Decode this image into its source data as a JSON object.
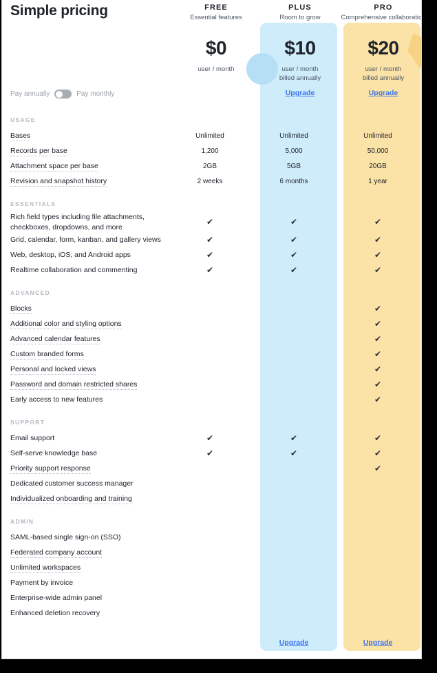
{
  "title": "Simple pricing",
  "billing": {
    "annual_label": "Pay annually",
    "monthly_label": "Pay monthly",
    "selected": "annually"
  },
  "plans": [
    {
      "name": "FREE",
      "tagline": "Essential features",
      "price": "$0",
      "unit": "user / month",
      "billed": "",
      "upgrade_label": "",
      "accent": "#ffffff"
    },
    {
      "name": "PLUS",
      "tagline": "Room to grow",
      "price": "$10",
      "unit": "user / month",
      "billed": "billed annually",
      "upgrade_label": "Upgrade",
      "accent": "#cfecfb"
    },
    {
      "name": "PRO",
      "tagline": "Comprehensive collaboration",
      "price": "$20",
      "unit": "user / month",
      "billed": "billed annually",
      "upgrade_label": "Upgrade",
      "accent": "#fbe3a7"
    }
  ],
  "link_color": "#3b74f2",
  "sections": [
    {
      "heading": "USAGE",
      "rows": [
        {
          "label": "Bases",
          "dotted": true,
          "free": "Unlimited",
          "plus": "Unlimited",
          "pro": "Unlimited"
        },
        {
          "label": "Records per base",
          "dotted": true,
          "free": "1,200",
          "plus": "5,000",
          "pro": "50,000"
        },
        {
          "label": "Attachment space per base",
          "dotted": true,
          "free": "2GB",
          "plus": "5GB",
          "pro": "20GB"
        },
        {
          "label": "Revision and snapshot history",
          "dotted": true,
          "free": "2 weeks",
          "plus": "6 months",
          "pro": "1 year"
        }
      ]
    },
    {
      "heading": "ESSENTIALS",
      "rows": [
        {
          "label": "Rich field types including file attachments, checkboxes, dropdowns, and more",
          "dotted": false,
          "free": "check",
          "plus": "check",
          "pro": "check"
        },
        {
          "label": "Grid, calendar, form, kanban, and gallery views",
          "dotted": false,
          "free": "check",
          "plus": "check",
          "pro": "check"
        },
        {
          "label": "Web, desktop, iOS, and Android apps",
          "dotted": false,
          "free": "check",
          "plus": "check",
          "pro": "check"
        },
        {
          "label": "Realtime collaboration and commenting",
          "dotted": false,
          "free": "check",
          "plus": "check",
          "pro": "check"
        }
      ]
    },
    {
      "heading": "ADVANCED",
      "rows": [
        {
          "label": "Blocks",
          "dotted": true,
          "free": "",
          "plus": "",
          "pro": "check"
        },
        {
          "label": "Additional color and styling options",
          "dotted": true,
          "free": "",
          "plus": "",
          "pro": "check"
        },
        {
          "label": "Advanced calendar features",
          "dotted": true,
          "free": "",
          "plus": "",
          "pro": "check"
        },
        {
          "label": "Custom branded forms",
          "dotted": true,
          "free": "",
          "plus": "",
          "pro": "check"
        },
        {
          "label": "Personal and locked views",
          "dotted": true,
          "free": "",
          "plus": "",
          "pro": "check"
        },
        {
          "label": "Password and domain restricted shares",
          "dotted": true,
          "free": "",
          "plus": "",
          "pro": "check"
        },
        {
          "label": "Early access to new features",
          "dotted": false,
          "free": "",
          "plus": "",
          "pro": "check"
        }
      ]
    },
    {
      "heading": "SUPPORT",
      "rows": [
        {
          "label": "Email support",
          "dotted": false,
          "free": "check",
          "plus": "check",
          "pro": "check"
        },
        {
          "label": "Self-serve knowledge base",
          "dotted": false,
          "free": "check",
          "plus": "check",
          "pro": "check"
        },
        {
          "label": "Priority support response",
          "dotted": true,
          "free": "",
          "plus": "",
          "pro": "check"
        },
        {
          "label": "Dedicated customer success manager",
          "dotted": false,
          "free": "",
          "plus": "",
          "pro": ""
        },
        {
          "label": "Individualized onboarding and training",
          "dotted": true,
          "free": "",
          "plus": "",
          "pro": ""
        }
      ]
    },
    {
      "heading": "ADMIN",
      "rows": [
        {
          "label": "SAML-based single sign-on (SSO)",
          "dotted": false,
          "free": "",
          "plus": "",
          "pro": ""
        },
        {
          "label": "Federated company account",
          "dotted": true,
          "free": "",
          "plus": "",
          "pro": ""
        },
        {
          "label": "Unlimited workspaces",
          "dotted": true,
          "free": "",
          "plus": "",
          "pro": ""
        },
        {
          "label": "Payment by invoice",
          "dotted": false,
          "free": "",
          "plus": "",
          "pro": ""
        },
        {
          "label": "Enterprise-wide admin panel",
          "dotted": false,
          "free": "",
          "plus": "",
          "pro": ""
        },
        {
          "label": "Enhanced deletion recovery",
          "dotted": false,
          "free": "",
          "plus": "",
          "pro": ""
        }
      ]
    }
  ],
  "footer": {
    "plus_upgrade_label": "Upgrade",
    "pro_upgrade_label": "Upgrade"
  },
  "icons": {
    "check": "✔"
  }
}
